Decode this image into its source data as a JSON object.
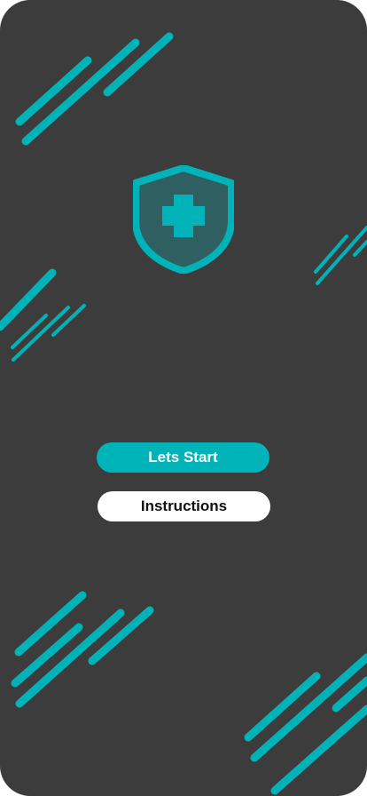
{
  "colors": {
    "background": "#3c3c3c",
    "accent": "#00b3b8",
    "shield_inner": "#2f5f61",
    "secondary_button_bg": "#ffffff",
    "secondary_button_text": "#111111"
  },
  "logo": {
    "icon": "medical-shield-cross-icon"
  },
  "buttons": {
    "start_label": "Lets Start",
    "instructions_label": "Instructions"
  }
}
